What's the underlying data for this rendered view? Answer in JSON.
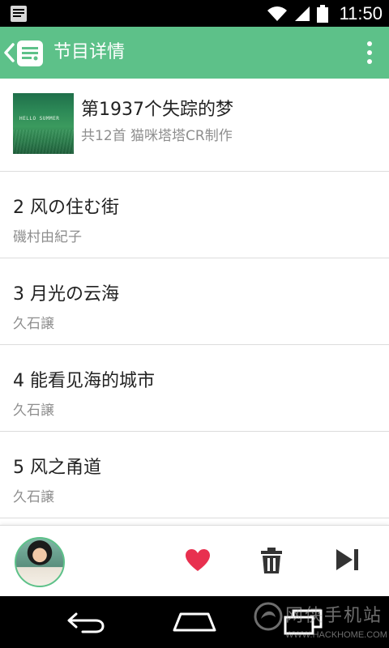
{
  "status_bar": {
    "time": "11:50",
    "icons": [
      "notification-icon",
      "wifi-icon",
      "signal-icon",
      "battery-icon"
    ]
  },
  "app_bar": {
    "title": "节目详情",
    "icons": [
      "back-chevron-icon",
      "radio-app-icon",
      "overflow-menu-icon"
    ],
    "background_color": "#5dc189"
  },
  "album": {
    "title": "第1937个失踪的梦",
    "subtitle": "共12首 猫咪塔塔CR制作",
    "cover_text": "HELLO SUMMER"
  },
  "tracks": [
    {
      "title": "2 风の住む街",
      "artist": "磯村由紀子"
    },
    {
      "title": "3 月光の云海",
      "artist": "久石譲"
    },
    {
      "title": "4 能看见海的城市",
      "artist": "久石譲"
    },
    {
      "title": "5 风之甬道",
      "artist": "久石譲"
    }
  ],
  "player": {
    "icons": [
      "avatar",
      "heart-icon",
      "trash-icon",
      "skip-next-icon"
    ],
    "heart_color": "#e8304f",
    "control_color": "#333333"
  },
  "nav_bar": {
    "icons": [
      "nav-back-icon",
      "nav-home-icon",
      "nav-recent-icon"
    ]
  },
  "watermark": {
    "text": "网侠手机站",
    "url": "WWW.HACKHOME.COM"
  }
}
